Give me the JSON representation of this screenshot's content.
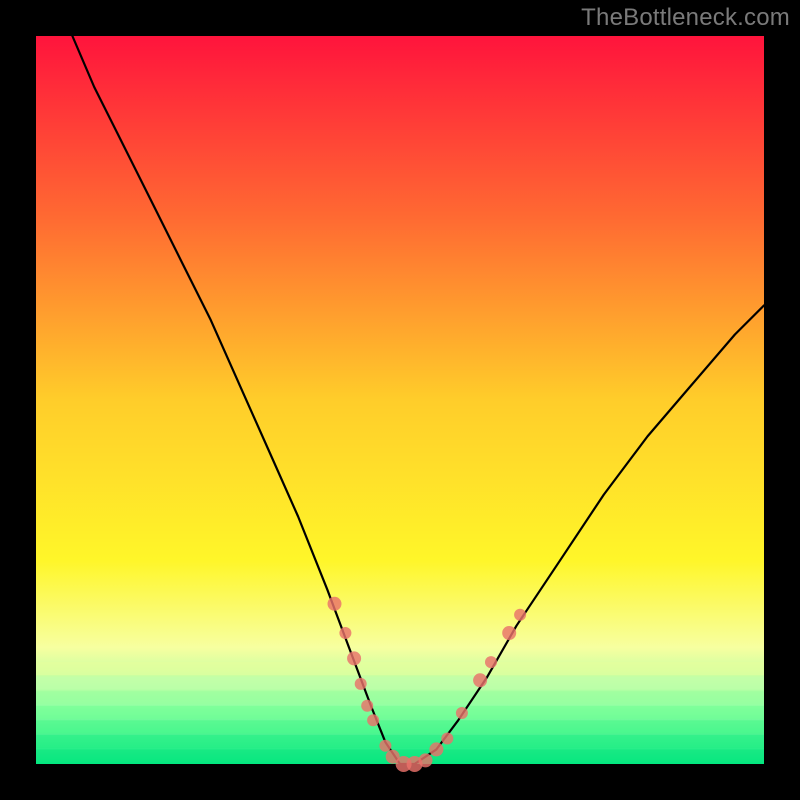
{
  "watermark": "TheBottleneck.com",
  "chart_data": {
    "type": "line",
    "title": "",
    "xlabel": "",
    "ylabel": "",
    "xlim": [
      0,
      100
    ],
    "ylim": [
      0,
      100
    ],
    "legend": false,
    "grid": false,
    "background_gradient": {
      "stops": [
        {
          "pos": 0.0,
          "color": "#ff143c"
        },
        {
          "pos": 0.25,
          "color": "#ff6a32"
        },
        {
          "pos": 0.5,
          "color": "#ffcd2a"
        },
        {
          "pos": 0.72,
          "color": "#fff629"
        },
        {
          "pos": 0.84,
          "color": "#f7ffa0"
        },
        {
          "pos": 0.92,
          "color": "#94ffa4"
        },
        {
          "pos": 1.0,
          "color": "#00e880"
        }
      ]
    },
    "series": [
      {
        "name": "bottleneck-curve",
        "type": "line",
        "color": "#000000",
        "x": [
          5.0,
          8.0,
          12.0,
          16.0,
          20.0,
          24.0,
          28.0,
          32.0,
          36.0,
          40.0,
          43.0,
          46.0,
          48.0,
          50.0,
          52.0,
          55.0,
          58.0,
          62.0,
          66.0,
          72.0,
          78.0,
          84.0,
          90.0,
          96.0,
          100.0
        ],
        "y": [
          100,
          93,
          85,
          77,
          69,
          61,
          52,
          43,
          34,
          24,
          16,
          8,
          3,
          0,
          0,
          2,
          6,
          12,
          19,
          28,
          37,
          45,
          52,
          59,
          63
        ]
      },
      {
        "name": "highlight-markers",
        "type": "scatter",
        "color": "#e9716a",
        "marker_radius_range": [
          5,
          9
        ],
        "points": [
          {
            "x": 41.0,
            "y": 22.0,
            "r": 7
          },
          {
            "x": 42.5,
            "y": 18.0,
            "r": 6
          },
          {
            "x": 43.7,
            "y": 14.5,
            "r": 7
          },
          {
            "x": 44.6,
            "y": 11.0,
            "r": 6
          },
          {
            "x": 45.5,
            "y": 8.0,
            "r": 6
          },
          {
            "x": 46.3,
            "y": 6.0,
            "r": 6
          },
          {
            "x": 48.0,
            "y": 2.5,
            "r": 6
          },
          {
            "x": 49.0,
            "y": 1.0,
            "r": 7
          },
          {
            "x": 50.5,
            "y": 0.0,
            "r": 8
          },
          {
            "x": 52.0,
            "y": 0.0,
            "r": 8
          },
          {
            "x": 53.5,
            "y": 0.5,
            "r": 7
          },
          {
            "x": 55.0,
            "y": 2.0,
            "r": 7
          },
          {
            "x": 56.5,
            "y": 3.5,
            "r": 6
          },
          {
            "x": 58.5,
            "y": 7.0,
            "r": 6
          },
          {
            "x": 61.0,
            "y": 11.5,
            "r": 7
          },
          {
            "x": 62.5,
            "y": 14.0,
            "r": 6
          },
          {
            "x": 65.0,
            "y": 18.0,
            "r": 7
          },
          {
            "x": 66.5,
            "y": 20.5,
            "r": 6
          }
        ]
      }
    ]
  }
}
